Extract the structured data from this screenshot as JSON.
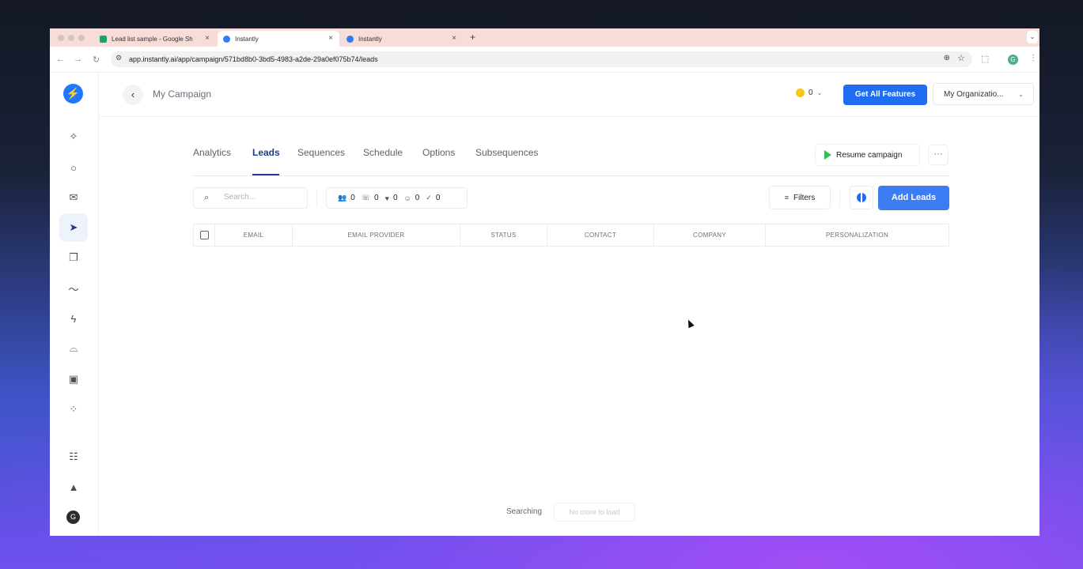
{
  "browser": {
    "tabs": [
      {
        "title": "Lead list sample - Google Sh",
        "icon": "sheets-icon",
        "close": "×"
      },
      {
        "title": "Instantly",
        "icon": "instantly-icon",
        "close": "×"
      },
      {
        "title": "Instantly",
        "icon": "instantly-icon",
        "close": "×"
      }
    ],
    "new_tab": "+",
    "url": "app.instantly.ai/app/campaign/571bd8b0-3bd5-4983-a2de-29a0ef075b74/leads",
    "profile_initial": "G"
  },
  "sidebar": {
    "logo_glyph": "⚡",
    "items": [
      {
        "name": "copilot",
        "glyph": "✧"
      },
      {
        "name": "search",
        "glyph": "○"
      },
      {
        "name": "inbox",
        "glyph": "✉"
      },
      {
        "name": "campaigns",
        "glyph": "➤",
        "active": true
      },
      {
        "name": "templates",
        "glyph": "❐"
      },
      {
        "name": "analytics",
        "glyph": "〜"
      },
      {
        "name": "automations",
        "glyph": "ϟ"
      },
      {
        "name": "ufo",
        "glyph": "⌓"
      },
      {
        "name": "unibox",
        "glyph": "▣"
      },
      {
        "name": "integrations",
        "glyph": "⁘"
      }
    ],
    "bottom": [
      {
        "name": "feedback",
        "glyph": "☷"
      },
      {
        "name": "rocket",
        "glyph": "▲"
      }
    ],
    "avatar_initial": "G"
  },
  "header": {
    "back": "‹",
    "campaign_name": "My Campaign",
    "credits": "0",
    "get_features_label": "Get All Features",
    "org_label": "My Organizatio...",
    "chevron": "⌄"
  },
  "campaign_tabs": [
    {
      "label": "Analytics"
    },
    {
      "label": "Leads",
      "active": true
    },
    {
      "label": "Sequences"
    },
    {
      "label": "Schedule"
    },
    {
      "label": "Options"
    },
    {
      "label": "Subsequences"
    }
  ],
  "actions": {
    "resume_label": "Resume campaign",
    "more": "···"
  },
  "toolbar": {
    "search_placeholder": "Search...",
    "stats": [
      {
        "name": "leads",
        "glyph": "👥",
        "value": "0"
      },
      {
        "name": "contacted",
        "glyph": "☏",
        "value": "0"
      },
      {
        "name": "interested",
        "glyph": "♥",
        "value": "0"
      },
      {
        "name": "replied",
        "glyph": "☺",
        "value": "0"
      },
      {
        "name": "completed",
        "glyph": "✓",
        "value": "0"
      }
    ],
    "filters_label": "Filters",
    "filter_glyph": "≡",
    "add_leads_label": "Add Leads"
  },
  "table": {
    "columns": [
      "EMAIL",
      "EMAIL PROVIDER",
      "STATUS",
      "CONTACT",
      "COMPANY",
      "PERSONALIZATION"
    ],
    "rows": []
  },
  "footer": {
    "searching_label": "Searching",
    "no_more_label": "No more to load"
  },
  "colors": {
    "primary": "#1f6df2",
    "accent_tab": "#1a3d8f",
    "play": "#2fbf59"
  }
}
